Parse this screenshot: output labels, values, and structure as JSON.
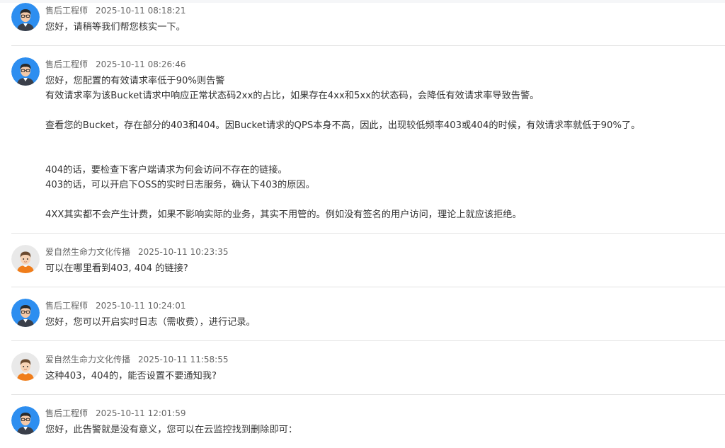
{
  "messages": [
    {
      "role": "engineer",
      "author": "售后工程师",
      "time": "2025-10-11 08:18:21",
      "lines": [
        "您好，请稍等我们帮您核实一下。"
      ]
    },
    {
      "role": "engineer",
      "author": "售后工程师",
      "time": "2025-10-11 08:26:46",
      "lines": [
        "您好，您配置的有效请求率低于90%则告警",
        "有效请求率为该Bucket请求中响应正常状态码2xx的占比，如果存在4xx和5xx的状态码，会降低有效请求率导致告警。",
        "",
        "查看您的Bucket，存在部分的403和404。因Bucket请求的QPS本身不高，因此，出现较低频率403或404的时候，有效请求率就低于90%了。",
        "",
        "",
        "404的话，要检查下客户端请求为何会访问不存在的链接。",
        "403的话，可以开启下OSS的实时日志服务，确认下403的原因。",
        "",
        "4XX其实都不会产生计费，如果不影响实际的业务，其实不用管的。例如没有签名的用户访问，理论上就应该拒绝。"
      ]
    },
    {
      "role": "customer",
      "author": "爱自然生命力文化传播",
      "time": "2025-10-11 10:23:35",
      "lines": [
        "可以在哪里看到403, 404 的链接?"
      ]
    },
    {
      "role": "engineer",
      "author": "售后工程师",
      "time": "2025-10-11 10:24:01",
      "lines": [
        "您好，您可以开启实时日志（需收费），进行记录。"
      ]
    },
    {
      "role": "customer",
      "author": "爱自然生命力文化传播",
      "time": "2025-10-11 11:58:55",
      "lines": [
        "这种403，404的，能否设置不要通知我?"
      ]
    },
    {
      "role": "engineer",
      "author": "售后工程师",
      "time": "2025-10-11 12:01:59",
      "lines": [
        "您好，此告警就是没有意义，您可以在云监控找到删除即可："
      ]
    }
  ],
  "colors": {
    "engineer_avatar_bg": "#2d8ef0",
    "customer_avatar_bg": "#e9e9e9",
    "divider": "#e3e3e3"
  },
  "icons": {
    "engineer": "engineer-avatar-icon",
    "customer": "customer-avatar-icon"
  }
}
